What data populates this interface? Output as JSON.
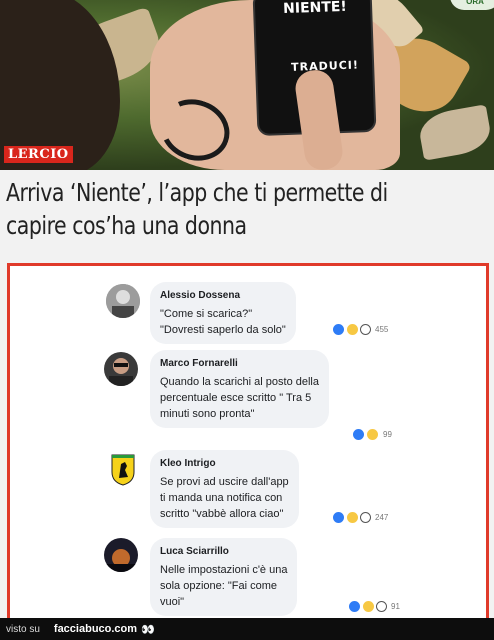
{
  "photo": {
    "phone_top_text": "NIENTE!",
    "phone_bottom_text": "TRADUCI!",
    "logo_text": "LERCIO",
    "badge_text": "ORA"
  },
  "headline": {
    "line1": "Arriva ‘Niente’, l’app che ti permette di",
    "line2": "capire cos’ha una donna"
  },
  "comments": [
    {
      "name": "Alessio Dossena",
      "lines": [
        "\"Come si scarica?\"",
        "\"Dovresti saperlo da solo\""
      ],
      "count": "455"
    },
    {
      "name": "Marco Fornarelli",
      "lines": [
        "Quando la scarichi al posto della",
        "percentuale esce scritto \" Tra 5",
        "minuti sono pronta\""
      ],
      "count": "99"
    },
    {
      "name": "Kleo Intrigo",
      "lines": [
        "Se provi ad uscire dall'app",
        "ti manda una notifica con",
        "scritto \"vabbè allora ciao\""
      ],
      "count": "247"
    },
    {
      "name": "Luca Sciarrillo",
      "lines": [
        "Nelle impostazioni c'è una",
        "sola opzione: \"Fai come",
        "vuoi\""
      ],
      "count": "91"
    }
  ],
  "footer": {
    "visto_su": "visto su",
    "site": "facciabuco.com",
    "eyes": "👀"
  },
  "colors": {
    "border_red": "#e03a2a",
    "like_blue": "#2e7cf6",
    "logo_red": "#d9261c"
  }
}
